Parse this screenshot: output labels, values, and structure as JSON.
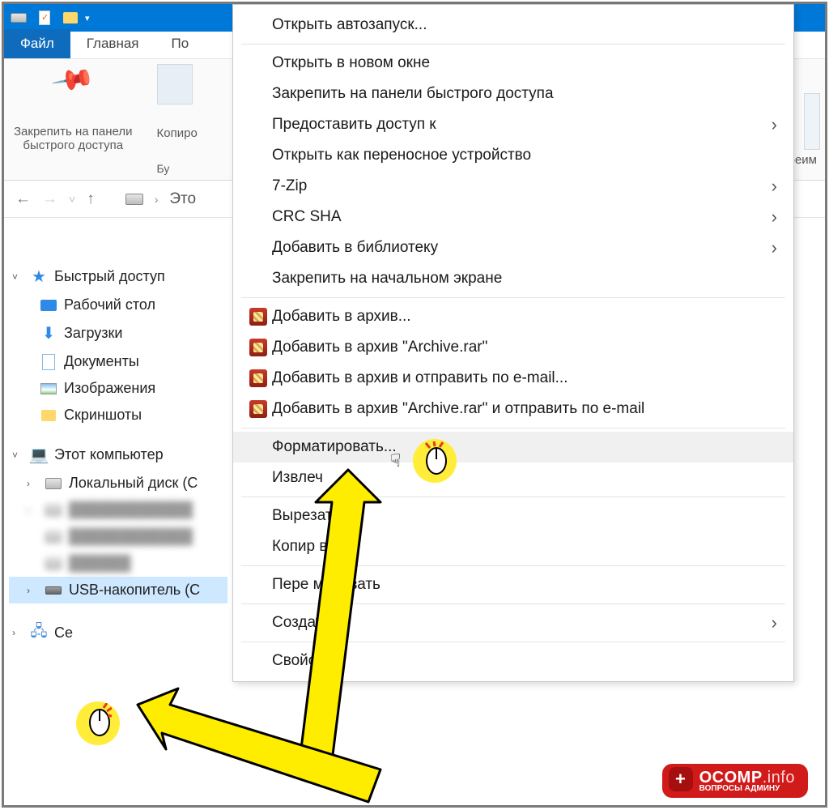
{
  "tabs": {
    "file": "Файл",
    "home": "Главная",
    "share_partial": "По"
  },
  "ribbon": {
    "pin_line1": "Закрепить на панели",
    "pin_line2": "быстрого доступа",
    "copy_partial": "Копиро",
    "clipboard_label_partial": "Бу",
    "preview_partial": "реим"
  },
  "breadcrumb": {
    "root_partial": "Это"
  },
  "sidebar": {
    "quick": "Быстрый доступ",
    "desktop": "Рабочий стол",
    "downloads": "Загрузки",
    "documents": "Документы",
    "pictures": "Изображения",
    "screenshots": "Скриншоты",
    "this_pc": "Этот компьютер",
    "local_disk": "Локальный диск (С",
    "usb": "USB-накопитель (С",
    "network_partial": "Се"
  },
  "ctx": {
    "autorun": "Открыть автозапуск...",
    "new_window": "Открыть в новом окне",
    "pin_quick": "Закрепить на панели быстрого доступа",
    "share": "Предоставить доступ к",
    "portable": "Открыть как переносное устройство",
    "sevenzip": "7-Zip",
    "crc": "CRC SHA",
    "library": "Добавить в библиотеку",
    "pin_start": "Закрепить на начальном экране",
    "rar_add": "Добавить в архив...",
    "rar_add_named": "Добавить в архив \"Archive.rar\"",
    "rar_email": "Добавить в архив и отправить по e-mail...",
    "rar_named_email": "Добавить в архив \"Archive.rar\" и отправить по e-mail",
    "format": "Форматировать...",
    "eject": "Извлеч",
    "cut": "Вырезать",
    "copy": "Копир    вать",
    "rename": "Пере    меновать",
    "create": "Создать",
    "properties": "Свойства"
  },
  "watermark": {
    "brand": "OCOMP",
    "tld": ".info",
    "sub": "ВОПРОСЫ АДМИНУ"
  }
}
